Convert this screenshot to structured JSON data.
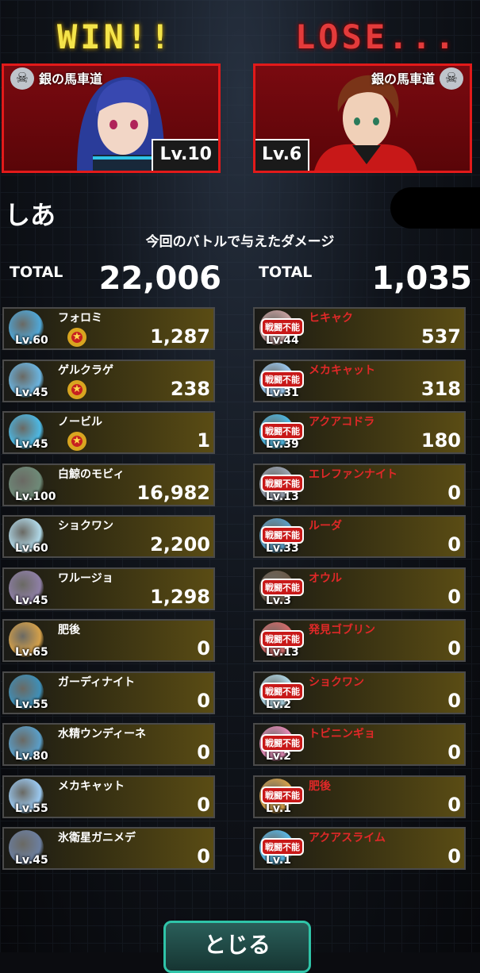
{
  "result": {
    "win": "WIN!!",
    "lose": "LOSE..."
  },
  "players": {
    "left": {
      "guild": "銀の馬車道",
      "level": "Lv.10"
    },
    "right": {
      "guild": "銀の馬車道",
      "level": "Lv.6"
    }
  },
  "player_name": "しあ",
  "damage_title": "今回のバトルで与えたダメージ",
  "totals": {
    "left": {
      "label": "TOTAL",
      "value": "22,006"
    },
    "right": {
      "label": "TOTAL",
      "value": "1,035"
    }
  },
  "knocked_out_label": "戦闘不能",
  "allies": [
    {
      "name": "フォロミ",
      "level": "Lv.60",
      "damage": "1,287",
      "medal": true,
      "color": "#4fa7d8"
    },
    {
      "name": "ゲルクラゲ",
      "level": "Lv.45",
      "damage": "238",
      "medal": true,
      "color": "#6ab4e0"
    },
    {
      "name": "ノービル",
      "level": "Lv.45",
      "damage": "1",
      "medal": true,
      "color": "#4cb8e4"
    },
    {
      "name": "白鯨のモビィ",
      "level": "Lv.100",
      "damage": "16,982",
      "medal": false,
      "color": "#6e8a78"
    },
    {
      "name": "ショクワン",
      "level": "Lv.60",
      "damage": "2,200",
      "medal": false,
      "color": "#b0d8e8"
    },
    {
      "name": "ワルージョ",
      "level": "Lv.45",
      "damage": "1,298",
      "medal": false,
      "color": "#8e7fa6"
    },
    {
      "name": "肥後",
      "level": "Lv.65",
      "damage": "0",
      "medal": false,
      "color": "#d4a04a"
    },
    {
      "name": "ガーディナイト",
      "level": "Lv.55",
      "damage": "0",
      "medal": false,
      "color": "#3e8fb8"
    },
    {
      "name": "水精ウンディーネ",
      "level": "Lv.80",
      "damage": "0",
      "medal": false,
      "color": "#5a9ec8"
    },
    {
      "name": "メカキャット",
      "level": "Lv.55",
      "damage": "0",
      "medal": false,
      "color": "#9ac8f0"
    },
    {
      "name": "氷衛星ガニメデ",
      "level": "Lv.45",
      "damage": "0",
      "medal": false,
      "color": "#6c7fa0"
    }
  ],
  "enemies": [
    {
      "name": "ヒキャク",
      "level": "Lv.44",
      "damage": "537",
      "color": "#c8a0a0"
    },
    {
      "name": "メカキャット",
      "level": "Lv.31",
      "damage": "318",
      "color": "#9ac8f0"
    },
    {
      "name": "アクアコドラ",
      "level": "Lv.39",
      "damage": "180",
      "color": "#4cb8e4"
    },
    {
      "name": "エレファンナイト",
      "level": "Lv.13",
      "damage": "0",
      "color": "#9aa4b4"
    },
    {
      "name": "ルーダ",
      "level": "Lv.33",
      "damage": "0",
      "color": "#5a9ec8"
    },
    {
      "name": "オウル",
      "level": "Lv.3",
      "damage": "0",
      "color": "#6a5a4a"
    },
    {
      "name": "発見ゴブリン",
      "level": "Lv.13",
      "damage": "0",
      "color": "#d46a6a"
    },
    {
      "name": "ショクワン",
      "level": "Lv.2",
      "damage": "0",
      "color": "#b0d8e8"
    },
    {
      "name": "トビニンギョ",
      "level": "Lv.2",
      "damage": "0",
      "color": "#e48ab8"
    },
    {
      "name": "肥後",
      "level": "Lv.1",
      "damage": "0",
      "color": "#d4a04a"
    },
    {
      "name": "アクアスライム",
      "level": "Lv.1",
      "damage": "0",
      "color": "#58b8e8"
    }
  ],
  "button": {
    "label": "とじる"
  }
}
